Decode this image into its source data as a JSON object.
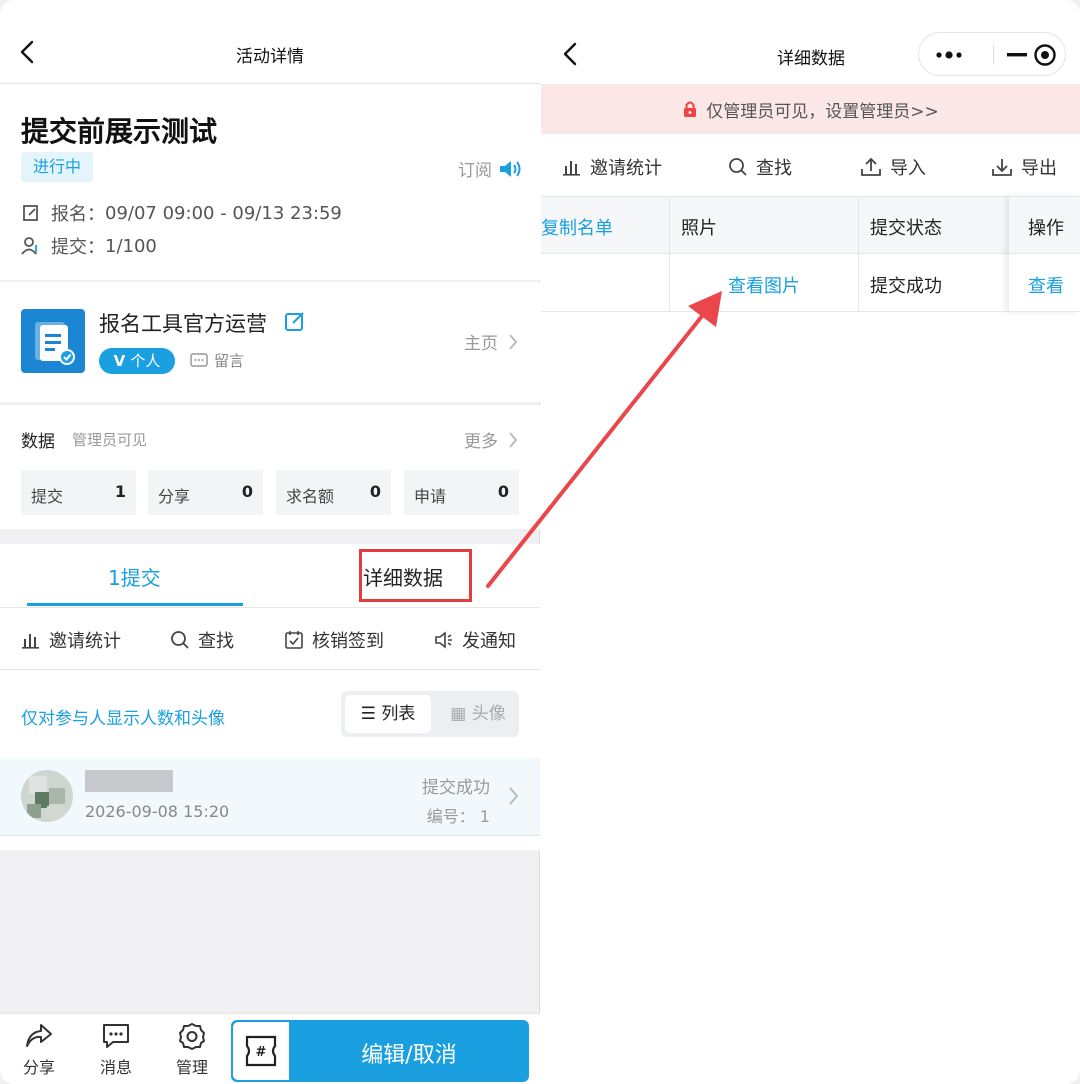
{
  "left": {
    "nav_title": "活动详情",
    "activity": {
      "title": "提交前展示测试",
      "status": "进行中",
      "subscribe": "订阅",
      "signup_label": "报名：",
      "signup_time": "09/07 09:00 - 09/13 23:59",
      "submit_label": "提交：",
      "submit_count": "1/100"
    },
    "organizer": {
      "name": "报名工具官方运营",
      "badge": "个人",
      "message": "留言",
      "homepage": "主页"
    },
    "data": {
      "title": "数据",
      "subtitle": "管理员可见",
      "more": "更多",
      "stats": [
        {
          "label": "提交",
          "value": "1"
        },
        {
          "label": "分享",
          "value": "0"
        },
        {
          "label": "求名额",
          "value": "0"
        },
        {
          "label": "申请",
          "value": "0"
        }
      ]
    },
    "tabs": {
      "active": "1提交",
      "detail": "详细数据"
    },
    "tools": [
      "邀请统计",
      "查找",
      "核销签到",
      "发通知"
    ],
    "notice": "仅对参与人显示人数和头像",
    "view_toggle": {
      "list": "列表",
      "avatar": "头像"
    },
    "entry": {
      "time": "2026-09-08 15:20",
      "status": "提交成功",
      "number": "编号：  1"
    },
    "bottom_bar": {
      "share": "分享",
      "messages": "消息",
      "manage": "管理",
      "edit_cancel": "编辑/取消"
    }
  },
  "right": {
    "nav_title": "详细数据",
    "warning": "仅管理员可见，设置管理员>>",
    "tools": [
      "邀请统计",
      "查找",
      "导入",
      "导出"
    ],
    "table": {
      "headers": [
        "复制名单",
        "照片",
        "提交状态",
        "操作"
      ],
      "rows": [
        {
          "photo": "查看图片",
          "status": "提交成功",
          "action": "查看"
        }
      ]
    }
  },
  "colors": {
    "accent": "#1aa0e0",
    "highlight_red": "#e23c3c",
    "warning_bg": "#fbe7e6"
  }
}
